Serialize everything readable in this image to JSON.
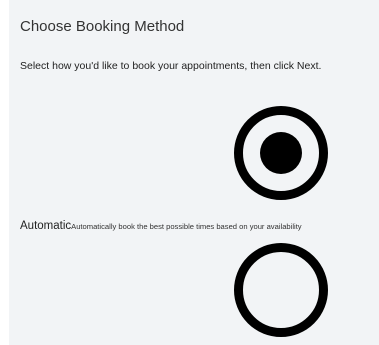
{
  "dialog": {
    "title": "Choose Booking Method",
    "instructions": "Select how you'd like to book your appointments, then click Next."
  },
  "options": [
    {
      "name": "Automatic",
      "description": "Automatically book the best possible times based on your availability",
      "selected": true
    },
    {
      "selected": false
    }
  ]
}
